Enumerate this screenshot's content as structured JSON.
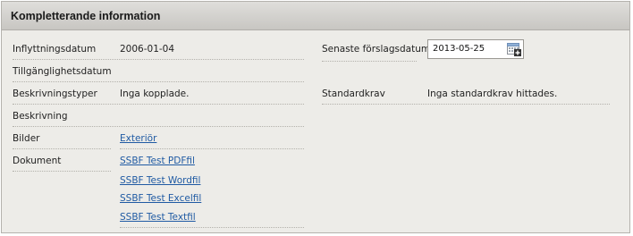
{
  "panel": {
    "title": "Kompletterande information"
  },
  "left": {
    "rows": [
      {
        "label": "Inflyttningsdatum",
        "value": "2006-01-04"
      },
      {
        "label": "Tillgänglighetsdatum",
        "value": ""
      },
      {
        "label": "Beskrivningstyper",
        "value": "Inga kopplade."
      },
      {
        "label": "Beskrivning",
        "value": ""
      },
      {
        "label": "Bilder",
        "links": [
          "Exteriör"
        ]
      },
      {
        "label": "Dokument",
        "links": [
          "SSBF Test PDFfil",
          "SSBF Test Wordfil",
          "SSBF Test Excelfil",
          "SSBF Test Textfil"
        ]
      }
    ]
  },
  "right": {
    "rows": [
      {
        "label": "Senaste förslagsdatum",
        "value": "2013-05-25",
        "icon": "calendar-icon"
      },
      {
        "label": "Standardkrav",
        "value": "Inga standardkrav hittades."
      }
    ]
  },
  "colors": {
    "panel_bg": "#edece8",
    "header_bg": "#cfcdc9",
    "link": "#1f5aa3"
  }
}
